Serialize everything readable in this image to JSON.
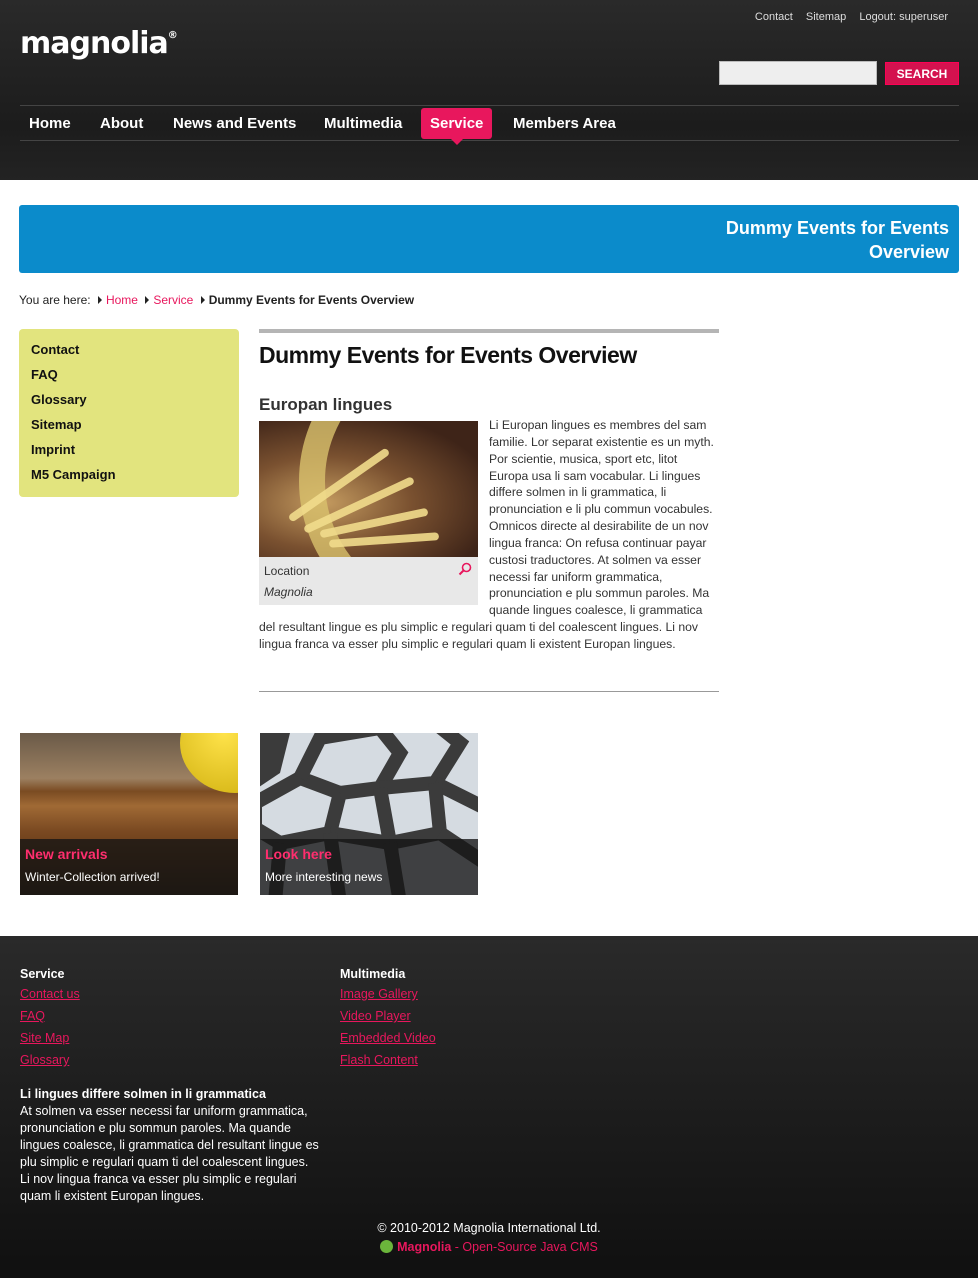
{
  "header": {
    "logo": "magnolia",
    "meta_nav": [
      "Contact",
      "Sitemap",
      "Logout: superuser"
    ],
    "search": {
      "placeholder": "",
      "button": "SEARCH"
    },
    "nav": [
      "Home",
      "About",
      "News and Events",
      "Multimedia",
      "Service",
      "Members Area"
    ],
    "active_nav": "Service"
  },
  "banner": {
    "title": "Dummy Events for Events Overview"
  },
  "breadcrumb": {
    "prefix": "You are here:",
    "items": [
      "Home",
      "Service"
    ],
    "current": "Dummy Events for Events Overview"
  },
  "subnav": [
    "Contact",
    "FAQ",
    "Glossary",
    "Sitemap",
    "Imprint",
    "M5 Campaign"
  ],
  "main": {
    "title": "Dummy Events for Events Overview",
    "section_title": "Europan lingues",
    "image_caption": "Location",
    "image_credit": "Magnolia",
    "body": "Li Europan lingues es membres del sam familie. Lor separat existentie es un myth. Por scientie, musica, sport etc, litot Europa usa li sam vocabular. Li lingues differe solmen in li grammatica, li pronunciation e li plu commun vocabules. Omnicos directe al desirabilite de un nov lingua franca: On refusa continuar payar custosi traductores. At solmen va esser necessi far uniform grammatica, pronunciation e plu sommun paroles. Ma quande lingues coalesce, li grammatica del resultant lingue es plu simplic e regulari quam ti del coalescent lingues. Li nov lingua franca va esser plu simplic e regulari quam li existent Europan lingues."
  },
  "teasers": [
    {
      "title": "New arrivals",
      "subtitle": "Winter-Collection arrived!"
    },
    {
      "title": "Look here",
      "subtitle": "More interesting news"
    }
  ],
  "footer": {
    "columns": [
      {
        "heading": "Service",
        "links": [
          "Contact us",
          "FAQ",
          "Site Map",
          "Glossary"
        ]
      },
      {
        "heading": "Multimedia",
        "links": [
          "Image Gallery",
          "Video Player",
          "Embedded Video",
          "Flash Content"
        ]
      }
    ],
    "text_heading": "Li lingues differe solmen in li grammatica",
    "text": "At solmen va esser necessi far uniform grammatica, pronunciation e plu sommun paroles. Ma quande lingues coalesce, li grammatica del resultant lingue es plu simplic e regulari quam ti del coalescent lingues. Li nov lingua franca va esser plu simplic e regulari quam li existent Europan lingues.",
    "copyright": "© 2010-2012 Magnolia International Ltd.",
    "powered_brand": "Magnolia",
    "powered_text": " - Open-Source Java CMS"
  },
  "colors": {
    "accent": "#e8175d",
    "banner": "#0b8bcb",
    "subnav_bg": "#e2e47e",
    "header_bg": "#222222"
  }
}
